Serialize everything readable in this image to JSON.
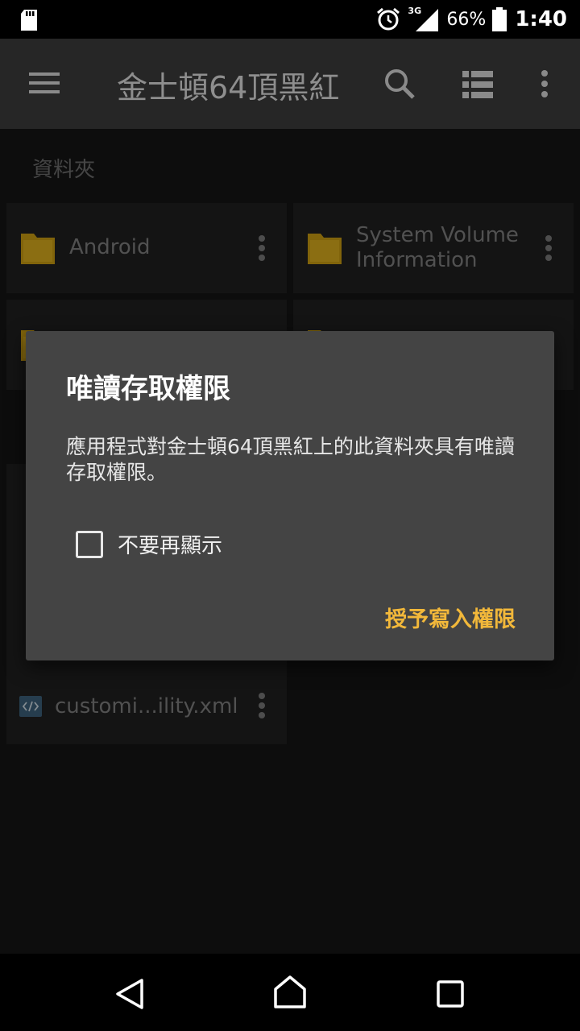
{
  "status": {
    "network": "3G",
    "battery": "66%",
    "time": "1:40"
  },
  "toolbar": {
    "title": "金士頓64頂黑紅"
  },
  "section": {
    "label": "資料夾"
  },
  "files": [
    {
      "name": "Android"
    },
    {
      "name": "System Volume Information"
    },
    {
      "name": "customi...ility.xml"
    }
  ],
  "dialog": {
    "title": "唯讀存取權限",
    "message": "應用程式對金士頓64頂黑紅上的此資料夾具有唯讀存取權限。",
    "checkbox_label": "不要再顯示",
    "action_label": "授予寫入權限"
  },
  "colors": {
    "folder": "#c79a12",
    "accent": "#f2b83a"
  }
}
